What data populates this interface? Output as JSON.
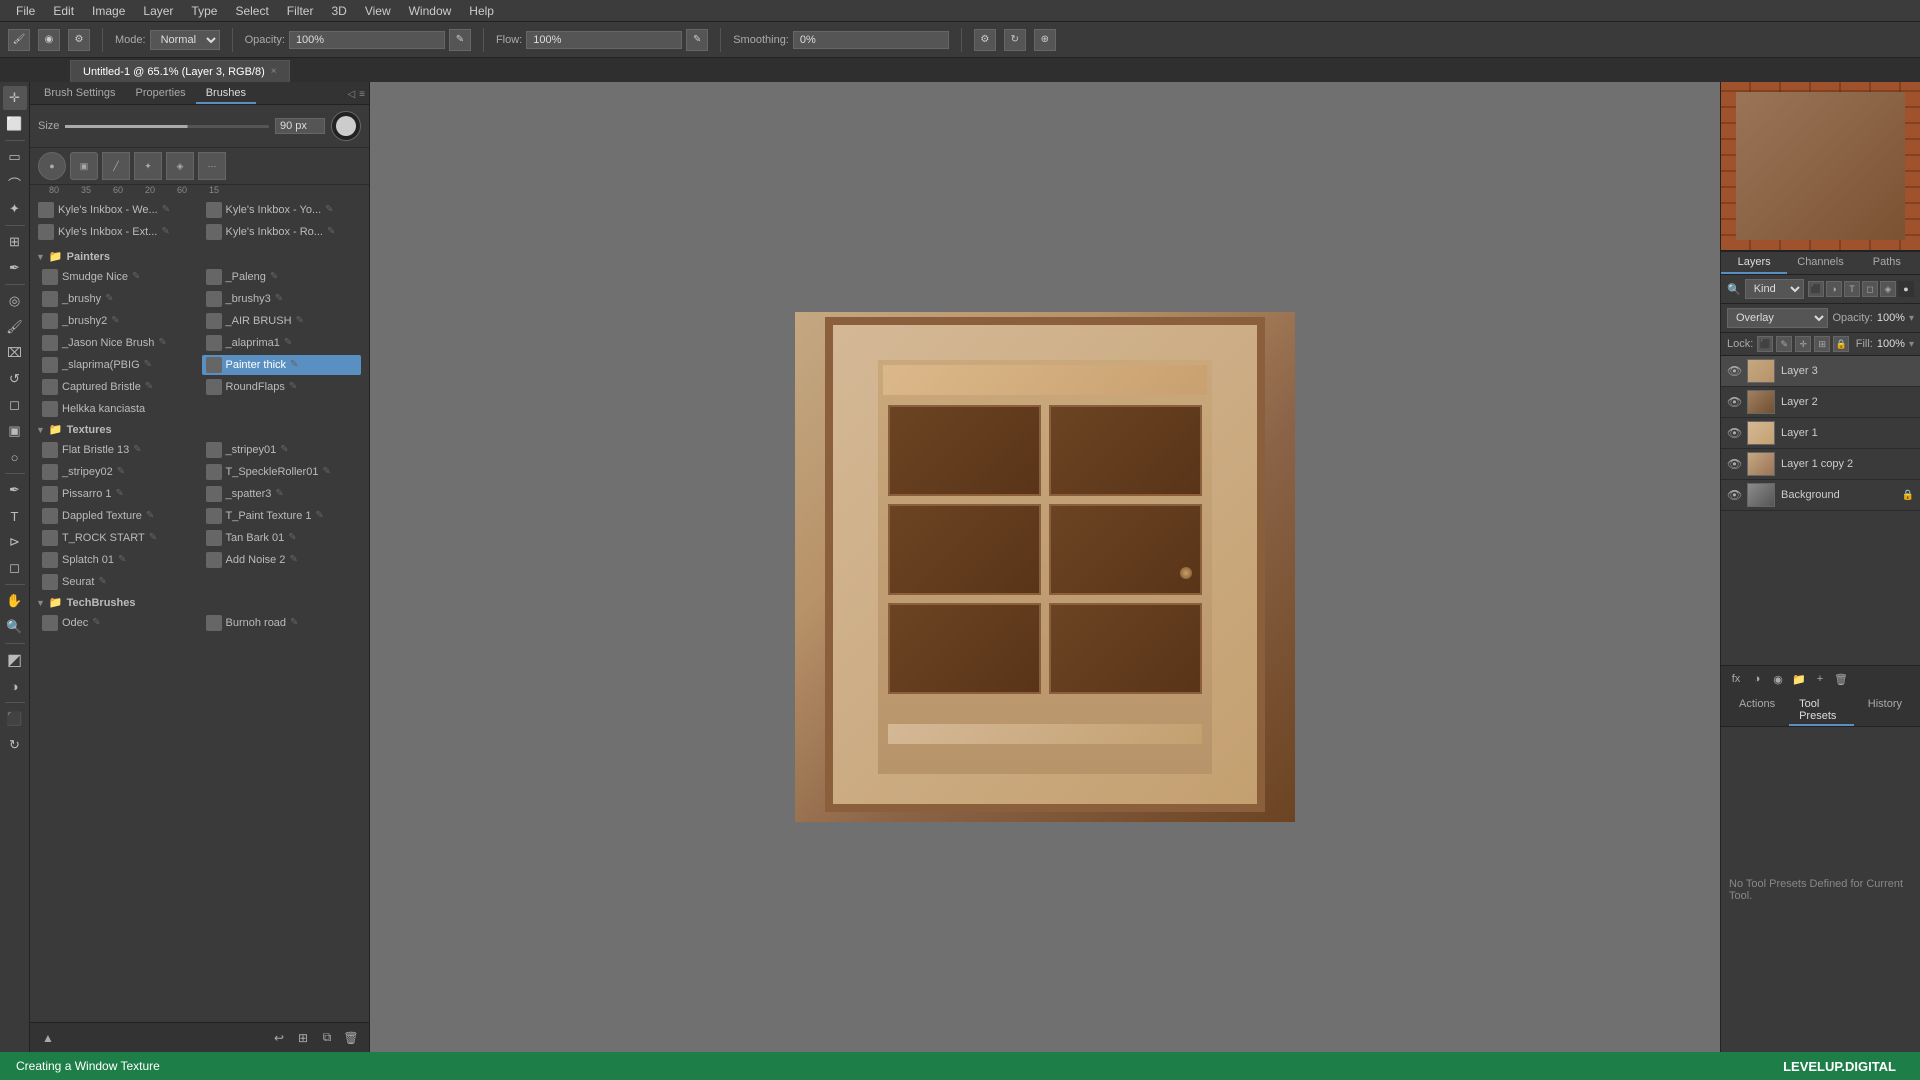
{
  "menubar": {
    "items": [
      "File",
      "Edit",
      "Image",
      "Layer",
      "Type",
      "Select",
      "Filter",
      "3D",
      "View",
      "Window",
      "Help"
    ]
  },
  "tooloptions": {
    "mode_label": "Mode:",
    "mode_value": "Normal",
    "opacity_label": "Opacity:",
    "opacity_value": "100%",
    "flow_label": "Flow:",
    "flow_value": "100%",
    "smoothing_label": "Smoothing:",
    "smoothing_value": "0%"
  },
  "tab": {
    "title": "Untitled-1 @ 65.1% (Layer 3, RGB/8)",
    "close": "×"
  },
  "brush_panel": {
    "tabs": [
      "Brush Settings",
      "Properties",
      "Brushes"
    ],
    "active_tab": "Brushes",
    "size_label": "Size",
    "size_value": "90 px",
    "brush_sizes": [
      "80",
      "35",
      "60",
      "20",
      "60",
      "15"
    ],
    "categories": [
      {
        "name": "Painters",
        "items_left": [
          "Smudge Nice",
          "_brushy",
          "_brushy2",
          "_Jason Nice Brush",
          "_slaprima(PBIG",
          "Captured Bristle",
          "Helkka kanciasta"
        ],
        "items_right": [
          "_Paleng",
          "_brushy3",
          "_AIR BRUSH",
          "_alaprima1",
          "Painter thick",
          "RoundFlaps"
        ]
      },
      {
        "name": "Textures",
        "items_left": [
          "Flat Bristle 13",
          "_stripey02",
          "Pissarro 1",
          "Dappled Texture",
          "T_ROCK START",
          "Splatch 01",
          "Seurat"
        ],
        "items_right": [
          "_stripey01",
          "T_SpeckleRoller01",
          "_spatter3",
          "T_Paint Texture 1",
          "Tan Bark 01",
          "Add Noise 2"
        ]
      },
      {
        "name": "TechBrushes",
        "items_left": [
          "Odec"
        ],
        "items_right": [
          "Burnoh road"
        ]
      }
    ],
    "presets_icons": [
      "80",
      "35",
      "60",
      "20",
      "60",
      "15"
    ],
    "recent_items_left": [
      "Kyle's Inkbox - We...",
      "Kyle's Inkbox - Ext..."
    ],
    "recent_items_right": [
      "Kyle's Inkbox - Yo...",
      "Kyle's Inkbox - Ro..."
    ]
  },
  "layers_panel": {
    "tabs": [
      "Layers",
      "Channels",
      "Paths"
    ],
    "active_tab": "Layers",
    "search_placeholder": "Kind",
    "blend_mode": "Overlay",
    "opacity_label": "Opacity:",
    "opacity_value": "100%",
    "lock_label": "Lock:",
    "fill_label": "Fill:",
    "fill_value": "100%",
    "layers": [
      {
        "name": "Layer 3",
        "visible": true,
        "selected": true,
        "locked": false
      },
      {
        "name": "Layer 2",
        "visible": true,
        "selected": false,
        "locked": false
      },
      {
        "name": "Layer 1",
        "visible": true,
        "selected": false,
        "locked": false
      },
      {
        "name": "Layer 1 copy 2",
        "visible": true,
        "selected": false,
        "locked": false
      },
      {
        "name": "Background",
        "visible": true,
        "selected": false,
        "locked": true
      }
    ]
  },
  "bottom_panel": {
    "tabs": [
      "Actions",
      "Tool Presets",
      "History"
    ],
    "active_tab": "Tool Presets",
    "empty_message": "No Tool Presets Defined for Current Tool."
  },
  "status_bar": {
    "text": "Creating a Window Texture",
    "brand": "LEVELUP.DIGITAL"
  }
}
